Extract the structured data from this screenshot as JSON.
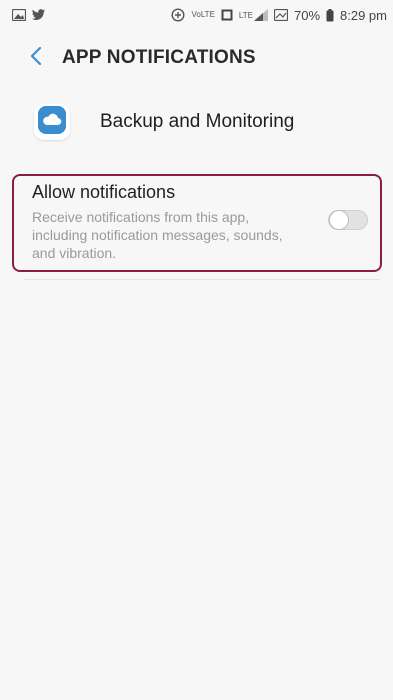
{
  "status_bar": {
    "left_icons": [
      "gallery-icon",
      "twitter-icon"
    ],
    "right_icons": [
      "data-saver-icon",
      "volte-icon",
      "screen-icon",
      "signal-icon",
      "battery-icon"
    ],
    "volte_text": "VoLTE",
    "signal_text": "LTE",
    "battery_percent": "70%",
    "time": "8:29 pm"
  },
  "header": {
    "back_icon": "chevron-left-icon",
    "title": "APP NOTIFICATIONS"
  },
  "app": {
    "icon": "cloud-icon",
    "name": "Backup and Monitoring"
  },
  "allow_notifications": {
    "title": "Allow notifications",
    "description": "Receive notifications from this app, including notification messages, sounds, and vibration.",
    "enabled": false
  },
  "colors": {
    "accent": "#3a8ecf",
    "highlight_border": "#8a1f3b",
    "background": "#f7f7f7"
  }
}
